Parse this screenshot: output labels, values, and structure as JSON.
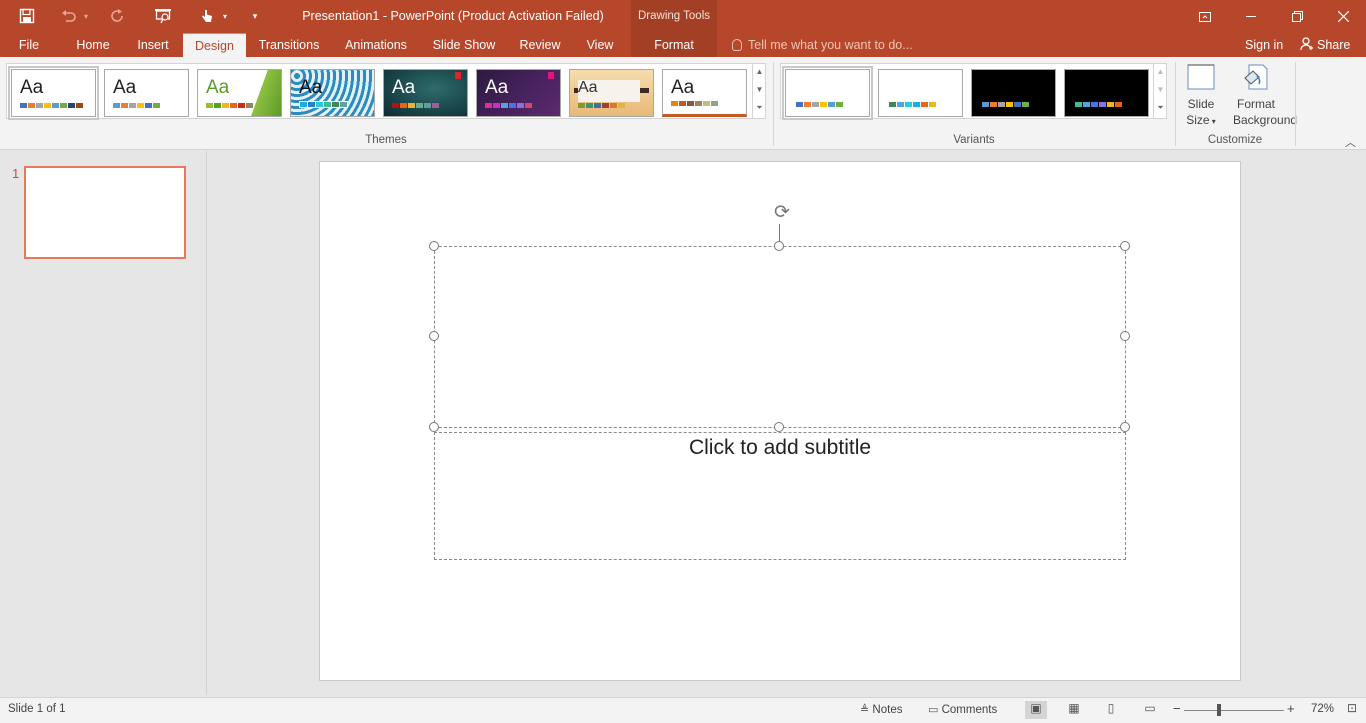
{
  "titlebar": {
    "title": "Presentation1 - PowerPoint (Product Activation Failed)",
    "contextual_header": "Drawing Tools",
    "qat_icons": [
      "save-icon",
      "undo-icon",
      "redo-icon",
      "slideshow-from-start-icon",
      "touch-mode-icon",
      "customize-qat-icon"
    ],
    "window_buttons": [
      "ribbon-display-options",
      "minimize",
      "restore",
      "close"
    ]
  },
  "tabs": {
    "file": "File",
    "home": "Home",
    "insert": "Insert",
    "design": "Design",
    "transitions": "Transitions",
    "animations": "Animations",
    "slideshow": "Slide Show",
    "review": "Review",
    "view": "View",
    "format": "Format",
    "active": "Design"
  },
  "tellme": {
    "placeholder": "Tell me what you want to do..."
  },
  "account": {
    "signin": "Sign in",
    "share": "Share"
  },
  "ribbon": {
    "themes": {
      "label": "Themes",
      "items": [
        {
          "text": "Aa",
          "selected": true
        },
        {
          "text": "Aa"
        },
        {
          "text": "Aa"
        },
        {
          "text": "Aa"
        },
        {
          "text": "Aa"
        },
        {
          "text": "Aa"
        },
        {
          "text": "Aa"
        },
        {
          "text": "Aa"
        }
      ]
    },
    "variants": {
      "label": "Variants"
    },
    "customize": {
      "label": "Customize",
      "slide_size_1": "Slide",
      "slide_size_2": "Size",
      "format_bg_1": "Format",
      "format_bg_2": "Background"
    }
  },
  "slides_pane": {
    "slide_number": "1"
  },
  "slide": {
    "subtitle_placeholder": "Click to add subtitle"
  },
  "statusbar": {
    "slide_info": "Slide 1 of 1",
    "notes": "Notes",
    "comments": "Comments",
    "zoom": "72%"
  },
  "colors": {
    "accent": "#b7472a",
    "accent_dark": "#a33f25",
    "ribbon_bg": "#f3f3f3",
    "workspace_bg": "#e6e6e6",
    "selection_outline": "#e6785e"
  }
}
